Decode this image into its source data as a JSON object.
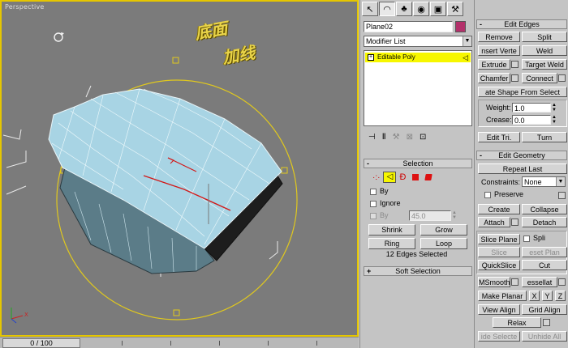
{
  "viewport": {
    "label": "Perspective"
  },
  "annotations": {
    "line1": "底面",
    "line2": "加线"
  },
  "timeline": {
    "slider": "0 / 100"
  },
  "panel": {
    "object_name": "Plane02",
    "object_color": "#b3306a",
    "modifier_list": "Modifier List",
    "stack_item": "Editable Poly"
  },
  "selection": {
    "title": "Selection",
    "by_vertex": "By",
    "ignore": "Ignore",
    "by_angle": "By",
    "angle_value": "45.0",
    "shrink": "Shrink",
    "grow": "Grow",
    "ring": "Ring",
    "loop": "Loop",
    "status": "12 Edges Selected"
  },
  "soft_selection": {
    "title": "Soft Selection"
  },
  "edit_edges": {
    "title": "Edit Edges",
    "remove": "Remove",
    "split": "Split",
    "insert_vertex": "nsert Verte",
    "weld": "Weld",
    "extrude": "Extrude",
    "target_weld": "Target Weld",
    "chamfer": "Chamfer",
    "connect": "Connect",
    "create_shape": "ate Shape From Select",
    "weight_label": "Weight:",
    "weight_value": "1.0",
    "crease_label": "Crease:",
    "crease_value": "0.0",
    "edit_tri": "Edit Tri.",
    "turn": "Turn"
  },
  "edit_geometry": {
    "title": "Edit Geometry",
    "repeat_last": "Repeat Last",
    "constraints_label": "Constraints:",
    "constraints_value": "None",
    "preserve": "Preserve",
    "create": "Create",
    "collapse": "Collapse",
    "attach": "Attach",
    "detach": "Detach",
    "slice_plane": "Slice Plane",
    "split": "Spli",
    "slice": "Slice",
    "reset_plane": "eset Plan",
    "quickslice": "QuickSlice",
    "cut": "Cut",
    "msmooth": "MSmooth",
    "tessellate": "essellat",
    "make_planar": "Make Planar",
    "x": "X",
    "y": "Y",
    "z": "Z",
    "view_align": "View Align",
    "grid_align": "Grid Align",
    "relax": "Relax",
    "hide_selected": "ide Selecte",
    "unhide_all": "Unhide All"
  },
  "colors": {
    "accent": "#e5c600",
    "stack_highlight": "#f7f700",
    "mesh_fill": "#a8d4e4"
  }
}
